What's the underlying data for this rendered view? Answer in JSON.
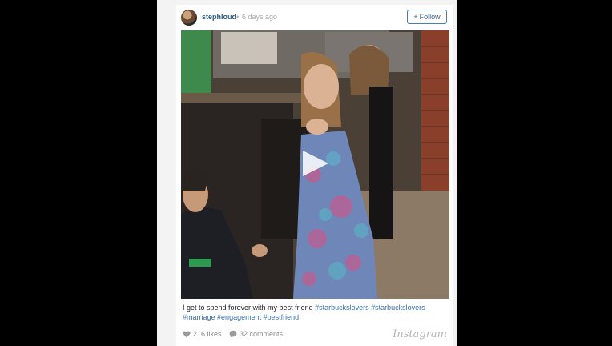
{
  "post": {
    "username": "stephloud",
    "separator": "•",
    "time_ago": "6 days ago",
    "follow_label": "Follow",
    "follow_icon": "plus-icon"
  },
  "media": {
    "type": "video",
    "play_icon": "play-icon"
  },
  "caption": {
    "text": "I get to spend forever with my best friend",
    "tags": [
      "#starbuckslovers",
      "#starbuckslovers",
      "#marriage",
      "#engagement",
      "#bestfriend"
    ]
  },
  "stats": {
    "likes": "216 likes",
    "comments": "32 comments"
  },
  "brand": {
    "logo_text": "Instagram",
    "link_color": "#3a6ea5",
    "username_color": "#2c5a85"
  }
}
